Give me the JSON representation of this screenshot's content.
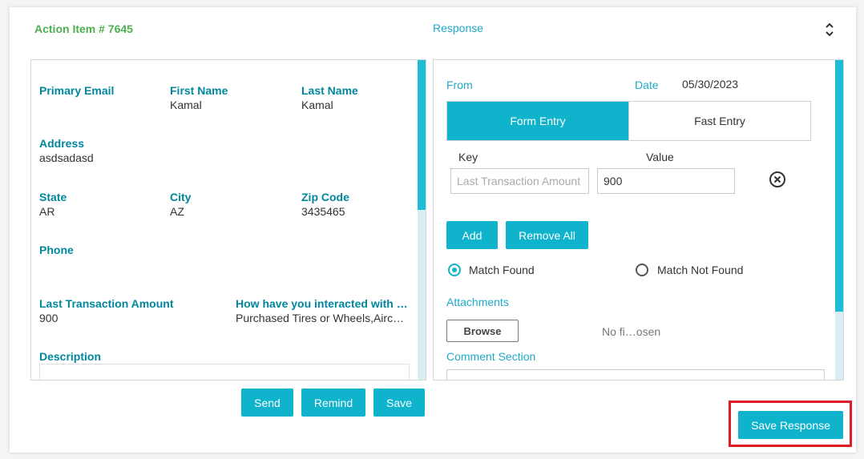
{
  "header": {
    "action_item_title": "Action Item # 7645",
    "response_title": "Response",
    "expand_icon": "chevron-up-down-icon"
  },
  "left_panel": {
    "fields": {
      "primary_email": {
        "label": "Primary Email",
        "value": ""
      },
      "first_name": {
        "label": "First Name",
        "value": "Kamal"
      },
      "last_name": {
        "label": "Last Name",
        "value": "Kamal"
      },
      "address": {
        "label": "Address",
        "value": "asdsadasd"
      },
      "state": {
        "label": "State",
        "value": "AR"
      },
      "city": {
        "label": "City",
        "value": "AZ"
      },
      "zip_code": {
        "label": "Zip Code",
        "value": "3435465"
      },
      "phone": {
        "label": "Phone",
        "value": ""
      },
      "last_transaction_amount": {
        "label": "Last Transaction Amount",
        "value": "900"
      },
      "interaction": {
        "label": "How have you interacted with …",
        "value": "Purchased Tires or Wheels,Airc…"
      },
      "description": {
        "label": "Description",
        "value": ""
      }
    },
    "buttons": {
      "send": "Send",
      "remind": "Remind",
      "save": "Save"
    }
  },
  "right_panel": {
    "from_label": "From",
    "date_label": "Date",
    "date_value": "05/30/2023",
    "tabs": {
      "form_entry": "Form Entry",
      "fast_entry": "Fast Entry",
      "active": "form_entry"
    },
    "key_header": "Key",
    "value_header": "Value",
    "entry": {
      "key_placeholder": "Last Transaction Amount",
      "value": "900"
    },
    "remove_icon": "circle-x-icon",
    "add_button": "Add",
    "remove_all_button": "Remove All",
    "match_found": "Match Found",
    "match_not_found": "Match Not Found",
    "match_selected": "match_found",
    "attachments_label": "Attachments",
    "browse_button": "Browse",
    "file_status": "No fi…osen",
    "comment_label": "Comment Section"
  },
  "footer": {
    "save_response_button": "Save Response"
  },
  "colors": {
    "accent": "#0fb3cc",
    "title_green": "#4caf50",
    "label_teal": "#00879e",
    "highlight_red": "#e01b24"
  }
}
